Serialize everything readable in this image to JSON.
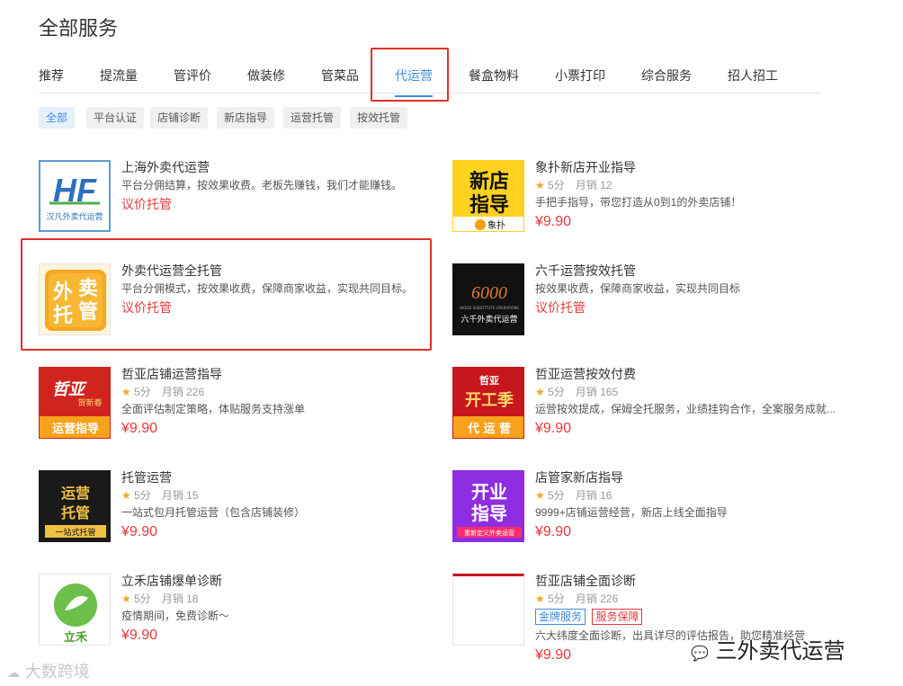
{
  "page_title": "全部服务",
  "tabs": [
    {
      "label": "推荐"
    },
    {
      "label": "提流量"
    },
    {
      "label": "管评价"
    },
    {
      "label": "做装修"
    },
    {
      "label": "管菜品"
    },
    {
      "label": "代运营"
    },
    {
      "label": "餐盒物料"
    },
    {
      "label": "小票打印"
    },
    {
      "label": "综合服务"
    },
    {
      "label": "招人招工"
    }
  ],
  "active_tab": "代运营",
  "filters": [
    {
      "label": "全部"
    },
    {
      "label": "平台认证"
    },
    {
      "label": "店铺诊断"
    },
    {
      "label": "新店指导"
    },
    {
      "label": "运营托管"
    },
    {
      "label": "按效托管"
    }
  ],
  "active_filter": "全部",
  "colors": {
    "accent": "#3d8ce6",
    "price": "#e4393c",
    "highlight_box": "#e0302a",
    "star": "#f5a623"
  },
  "products": [
    {
      "title": "上海外卖代运营",
      "desc": "平台分佣结算，按效果收费。老板先赚钱，我们才能赚钱。",
      "price_note": "议价托管",
      "thumb": {
        "logo": "HF",
        "caption": "汉凡外卖代运营"
      }
    },
    {
      "title": "象扑新店开业指导",
      "rating": "5分",
      "sales": "月销 12",
      "desc": "手把手指导，带您打造从0到1的外卖店铺！",
      "price": "¥9.90",
      "thumb": {
        "line1": "新店",
        "line2": "指导",
        "brand": "象扑"
      }
    },
    {
      "title": "外卖代运营全托管",
      "desc": "平台分佣模式，按效果收费，保障商家收益，实现共同目标。",
      "price_note": "议价托管",
      "thumb": {
        "chars": [
          "外",
          "卖",
          "托",
          "管"
        ]
      }
    },
    {
      "title": "六千运营按效托管",
      "desc": "按效果收费，保障商家收益，实现共同目标",
      "price_note": "议价托管",
      "thumb": {
        "logo": "6000",
        "subtitle": "WOOD SUBSTITUTE OPERATIONS",
        "caption": "六千外卖代运营"
      }
    },
    {
      "title": "哲亚店铺运营指导",
      "rating": "5分",
      "sales": "月销 226",
      "desc": "全面评估制定策略，体贴服务支持涨单",
      "price": "¥9.90",
      "thumb": {
        "brand": "哲亚",
        "tag": "贺新春",
        "caption": "运营指导"
      }
    },
    {
      "title": "哲亚运营按效付费",
      "rating": "5分",
      "sales": "月销 165",
      "desc": "运营按效提成，保姆全托服务，业绩挂钩合作，全案服务成就...",
      "price": "¥9.90",
      "thumb": {
        "brand": "哲亚",
        "line1": "开工季",
        "caption": "代 运 营"
      }
    },
    {
      "title": "托管运营",
      "rating": "5分",
      "sales": "月销 15",
      "desc": "一站式包月托管运营（包含店铺装修）",
      "price": "¥9.90",
      "thumb": {
        "line1": "运营",
        "line2": "托管",
        "caption": "一站式托管"
      }
    },
    {
      "title": "店管家新店指导",
      "rating": "5分",
      "sales": "月销 16",
      "desc": "9999+店铺运营经营，新店上线全面指导",
      "price": "¥9.90",
      "thumb": {
        "line1": "开业",
        "line2": "指导",
        "caption": "重新定义外卖运营"
      }
    },
    {
      "title": "立禾店铺爆单诊断",
      "rating": "5分",
      "sales": "月销 18",
      "desc": "疫情期间，免费诊断～",
      "price": "¥9.90",
      "thumb": {
        "caption": "立禾"
      }
    },
    {
      "title": "哲亚店铺全面诊断",
      "rating": "5分",
      "sales": "月销 226",
      "badges": [
        "金牌服务",
        "服务保障"
      ],
      "desc": "六大纬度全面诊断，出具详尽的评估报告，助您精准经营",
      "price": "¥9.90",
      "thumb": {}
    }
  ],
  "watermarks": {
    "left": "大数跨境",
    "right": "三外卖代运营"
  }
}
